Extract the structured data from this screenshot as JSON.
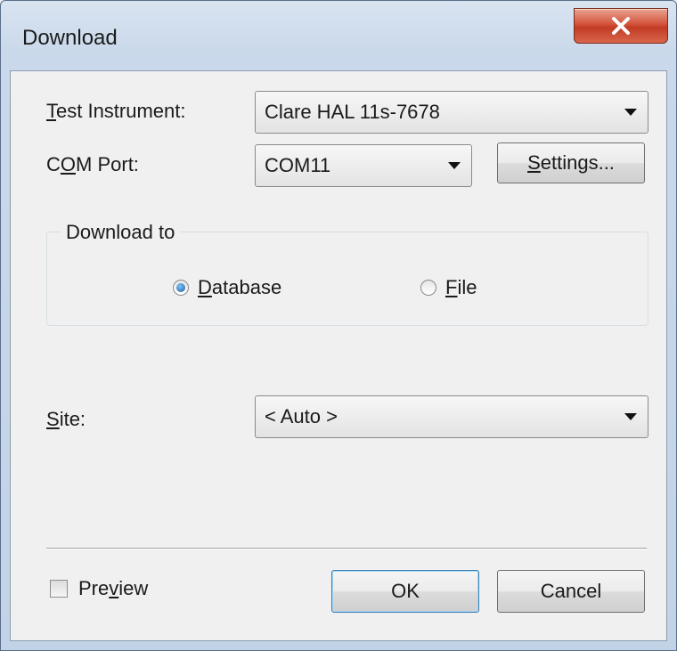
{
  "window": {
    "title": "Download",
    "close_icon": "close-x-icon",
    "close_color": "#c94a31"
  },
  "form": {
    "test_instrument": {
      "label_ul": "T",
      "label_rest": "est Instrument:",
      "value": "Clare HAL 11s-7678"
    },
    "com_port": {
      "label_pre": "C",
      "label_ul": "O",
      "label_post": "M Port:",
      "value": "COM11"
    },
    "settings_button": {
      "label_ul": "S",
      "label_rest": "ettings..."
    },
    "download_to": {
      "legend": "Download to",
      "database": {
        "label_ul": "D",
        "label_rest": "atabase",
        "selected": true
      },
      "file": {
        "label_ul": "F",
        "label_rest": "ile",
        "selected": false
      }
    },
    "site": {
      "label_ul": "S",
      "label_rest": "ite:",
      "value": "< Auto >"
    }
  },
  "footer": {
    "preview": {
      "label_pre": "Pre",
      "label_ul": "v",
      "label_post": "iew",
      "checked": false
    },
    "ok_label": "OK",
    "cancel_label": "Cancel"
  }
}
